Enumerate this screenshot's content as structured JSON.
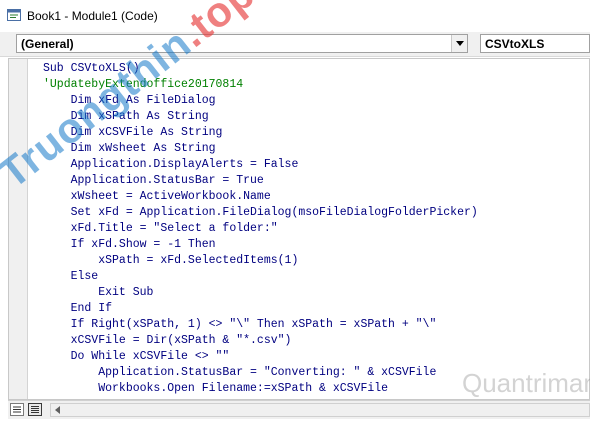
{
  "window": {
    "title": "Book1 - Module1 (Code)"
  },
  "toolbar": {
    "object_combo_value": "(General)",
    "procedure_combo_value": "CSVtoXLS"
  },
  "code_lines": [
    {
      "text": "Sub CSVtoXLS()",
      "type": "code"
    },
    {
      "text": "'UpdatebyExtendoffice20170814",
      "type": "comment"
    },
    {
      "text": "    Dim xFd As FileDialog",
      "type": "code"
    },
    {
      "text": "    Dim xSPath As String",
      "type": "code"
    },
    {
      "text": "    Dim xCSVFile As String",
      "type": "code"
    },
    {
      "text": "    Dim xWsheet As String",
      "type": "code"
    },
    {
      "text": "    Application.DisplayAlerts = False",
      "type": "code"
    },
    {
      "text": "    Application.StatusBar = True",
      "type": "code"
    },
    {
      "text": "    xWsheet = ActiveWorkbook.Name",
      "type": "code"
    },
    {
      "text": "    Set xFd = Application.FileDialog(msoFileDialogFolderPicker)",
      "type": "code"
    },
    {
      "text": "    xFd.Title = \"Select a folder:\"",
      "type": "code"
    },
    {
      "text": "    If xFd.Show = -1 Then",
      "type": "code"
    },
    {
      "text": "        xSPath = xFd.SelectedItems(1)",
      "type": "code"
    },
    {
      "text": "    Else",
      "type": "code"
    },
    {
      "text": "        Exit Sub",
      "type": "code"
    },
    {
      "text": "    End If",
      "type": "code"
    },
    {
      "text": "    If Right(xSPath, 1) <> \"\\\" Then xSPath = xSPath + \"\\\"",
      "type": "code"
    },
    {
      "text": "    xCSVFile = Dir(xSPath & \"*.csv\")",
      "type": "code"
    },
    {
      "text": "    Do While xCSVFile <> \"\"",
      "type": "code"
    },
    {
      "text": "        Application.StatusBar = \"Converting: \" & xCSVFile",
      "type": "code"
    },
    {
      "text": "        Workbooks.Open Filename:=xSPath & xCSVFile",
      "type": "code"
    }
  ],
  "watermark": {
    "left_text": "Truongthin",
    "left_accent": ".top",
    "right_text": "Quantrimang"
  },
  "colors": {
    "code_text": "#000080",
    "comment_text": "#008000",
    "chrome_bg": "#f0f0f0"
  },
  "icons": {
    "app": "excel-vba-icon",
    "dropdown": "chevron-down-icon",
    "procedure_view": "procedure-view-icon",
    "full_module_view": "full-module-view-icon",
    "scroll_left": "scroll-left-arrow-icon"
  }
}
